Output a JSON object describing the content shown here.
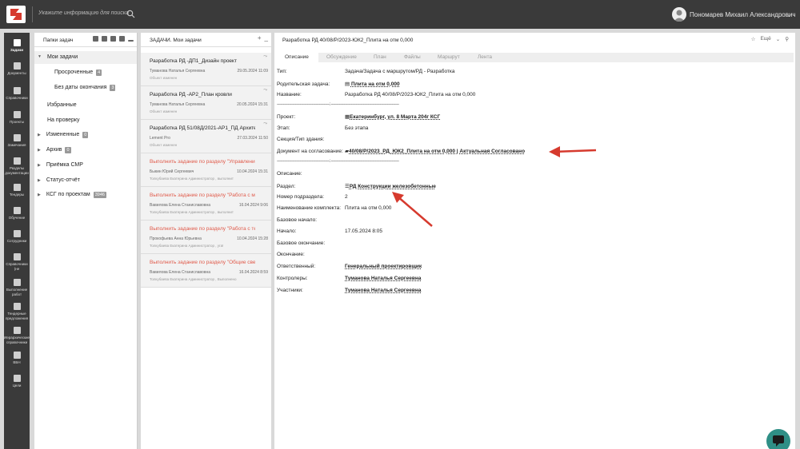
{
  "topbar": {
    "search_placeholder": "Укажите информацию для поиска",
    "user_name": "Пономарев Михаил Александрович"
  },
  "nav": [
    {
      "icon": "tasks-icon",
      "label": "Задачи"
    },
    {
      "icon": "documents-icon",
      "label": "Документы"
    },
    {
      "icon": "directories-icon",
      "label": "Справочники"
    },
    {
      "icon": "projects-icon",
      "label": "Проекты"
    },
    {
      "icon": "remarks-icon",
      "label": "Замечания"
    },
    {
      "icon": "doc-sections-icon",
      "label": "Разделы документации"
    },
    {
      "icon": "tenders-icon",
      "label": "Тендеры"
    },
    {
      "icon": "training-icon",
      "label": "Обучение"
    },
    {
      "icon": "staff-icon",
      "label": "Сотрудники"
    },
    {
      "icon": "reference-icon",
      "label": "Справочники (не"
    },
    {
      "icon": "works-icon",
      "label": "Выполнение работ"
    },
    {
      "icon": "tender-offers-icon",
      "label": "Тендерные предложения"
    },
    {
      "icon": "hierarchy-icon",
      "label": "Иерархические справочники"
    },
    {
      "icon": "vbn-icon",
      "label": "ВБН"
    },
    {
      "icon": "goals-icon",
      "label": "Цели"
    }
  ],
  "folders": {
    "title": "Папки задач",
    "items": [
      {
        "label": "Мои задачи",
        "badge": ""
      },
      {
        "label": "Просроченные",
        "badge": "4"
      },
      {
        "label": "Без даты окончания",
        "badge": "3"
      },
      {
        "label": "Избранные",
        "badge": ""
      },
      {
        "label": "На проверку",
        "badge": ""
      },
      {
        "label": "Измененные",
        "badge": "0"
      },
      {
        "label": "Архив",
        "badge": "0"
      },
      {
        "label": "Приёмка СМР",
        "badge": ""
      },
      {
        "label": "Статус-отчёт",
        "badge": ""
      },
      {
        "label": "КСГ по проектам",
        "badge": "3946"
      }
    ]
  },
  "tasks": {
    "title": "ЗАДАЧИ. Мои задачи",
    "items": [
      {
        "title": "Разработка РД -ДП1_Дизайн проект",
        "person": "Туманова Наталья Сергеевна",
        "date": "29.05.2024 11:09",
        "status": "Объект изменен"
      },
      {
        "title": "Разработка РД -АР2_План кровли",
        "person": "Туманова Наталья Сергеевна",
        "date": "20.05.2024 15:31",
        "status": "Объект изменен"
      },
      {
        "title": "Разработка РД 51/08Д/2021-АР1_ПД Архите",
        "person": "Lement Pro",
        "date": "27.03.2024 11:50",
        "status": "Объект изменен"
      },
      {
        "title": "Выполнить задание по разделу \"Управление ...",
        "person": "Быкин Юрий Сергеевич",
        "date": "10.04.2024 15:31",
        "status": "Толкубаева Екатерина Администратор , выполнит"
      },
      {
        "title": "Выполнить задание по разделу \"Работа с мо ...",
        "person": "Вавилова Елена Станиславовна",
        "date": "16.04.2024 9:06",
        "status": "Толкубаева Екатерина Администратор , выполнит"
      },
      {
        "title": "Выполнить задание по разделу \"Работа с тех ...",
        "person": "Прокофьева Анна Юрьевна",
        "date": "10.04.2024 15:28",
        "status": "Толкубаева Екатерина Администратор , уга!"
      },
      {
        "title": "Выполнить задание по разделу \"Общие свед ...",
        "person": "Вавилова Елена Станиславовна",
        "date": "16.04.2024 8:59",
        "status": "Толкубаева Екатерина Администратор , Выполнено"
      }
    ]
  },
  "detail": {
    "title": "Разработка РД 40/08/Р/2023-ЮК2_Плита на отм 0,000",
    "more_label": "Ещё",
    "tabs": [
      "Описание",
      "Обсуждение",
      "План",
      "Файлы",
      "Маршрут",
      "Лента"
    ],
    "separator": "--------------------------------------------:---------------------------------------------------------",
    "fields": {
      "type": {
        "k": "Тип:",
        "v": "Задача/Задача с маршрутом/РД - Разработка"
      },
      "parent": {
        "k": "Родительская задача:",
        "v": "Плита на отм 0,000"
      },
      "name": {
        "k": "Название:",
        "v": "Разработка РД 40/08/Р/2023-ЮК2_Плита на отм 0,000"
      },
      "project": {
        "k": "Проект:",
        "v": "Екатеринбург, ул. 8 Марта 204г КСГ"
      },
      "stage": {
        "k": "Этап:",
        "v": "Без этапа"
      },
      "section_type": {
        "k": "Секция/Тип здания:",
        "v": ""
      },
      "doc": {
        "k": "Документ на согласование:",
        "v": "40/08/Р/2023_РД_ЮК2_Плита на отм 0,000 | Актуальная Согласовано"
      },
      "description": {
        "k": "Описание:",
        "v": ""
      },
      "section": {
        "k": "Раздел:",
        "v": "РД Конструкции железобетонные"
      },
      "subsection_no": {
        "k": "Номер подраздела:",
        "v": "2"
      },
      "kit_name": {
        "k": "Наименование комплекта:",
        "v": "Плита на отм 0,000"
      },
      "base_start": {
        "k": "Базовое начало:",
        "v": ""
      },
      "start": {
        "k": "Начало:",
        "v": "17.05.2024 8:05"
      },
      "base_end": {
        "k": "Базовое окончание:",
        "v": ""
      },
      "end": {
        "k": "Окончание:",
        "v": ""
      },
      "responsible": {
        "k": "Ответственный:",
        "v": "Генеральный проектировщик"
      },
      "controllers": {
        "k": "Контролеры:",
        "v": "Туманова Наталья Сергеевна"
      },
      "participants": {
        "k": "Участники:",
        "v": "Туманова Наталья Сергеевна"
      }
    }
  },
  "colors": {
    "topbar": "#3a3a3a",
    "accent_red": "#d63a2e",
    "task_overdue": "#e05a4a",
    "chat": "#2f8f86"
  }
}
